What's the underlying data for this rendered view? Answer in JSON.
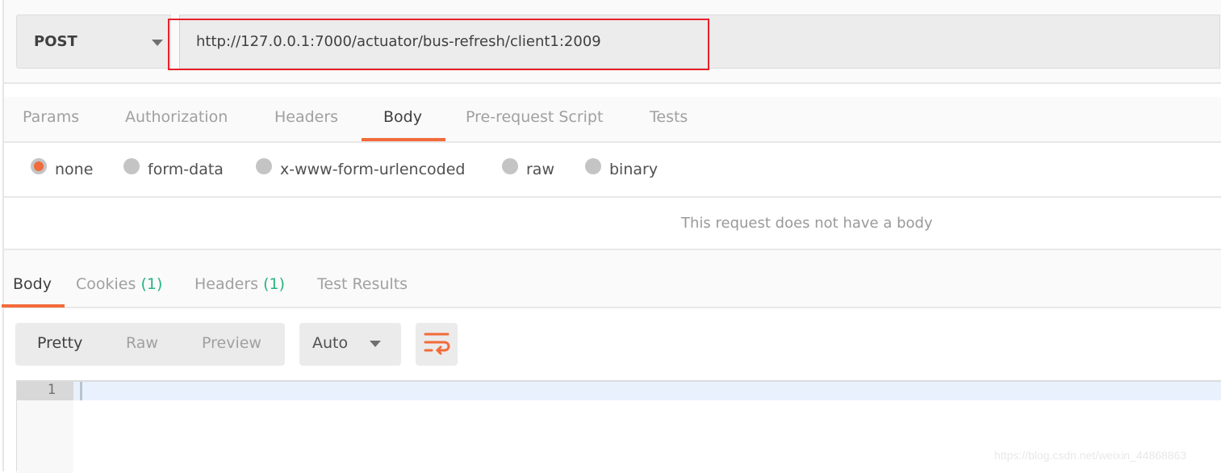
{
  "request": {
    "method": "POST",
    "url": "http://127.0.0.1:7000/actuator/bus-refresh/client1:2009"
  },
  "request_tabs": [
    "Params",
    "Authorization",
    "Headers",
    "Body",
    "Pre-request Script",
    "Tests"
  ],
  "active_request_tab": "Body",
  "body_modes": [
    "none",
    "form-data",
    "x-www-form-urlencoded",
    "raw",
    "binary"
  ],
  "selected_body_mode": "none",
  "no_body_message": "This request does not have a body",
  "response_tabs": {
    "body": "Body",
    "cookies": "Cookies",
    "cookies_count": "(1)",
    "headers": "Headers",
    "headers_count": "(1)",
    "test_results": "Test Results"
  },
  "view_modes": [
    "Pretty",
    "Raw",
    "Preview"
  ],
  "active_view_mode": "Pretty",
  "format": "Auto",
  "editor": {
    "line_numbers": [
      "1"
    ]
  },
  "watermark": "https://blog.csdn.net/weixin_44868863",
  "colors": {
    "accent": "#f26b3a",
    "highlight_box": "#e8202a",
    "count": "#26b47f"
  }
}
